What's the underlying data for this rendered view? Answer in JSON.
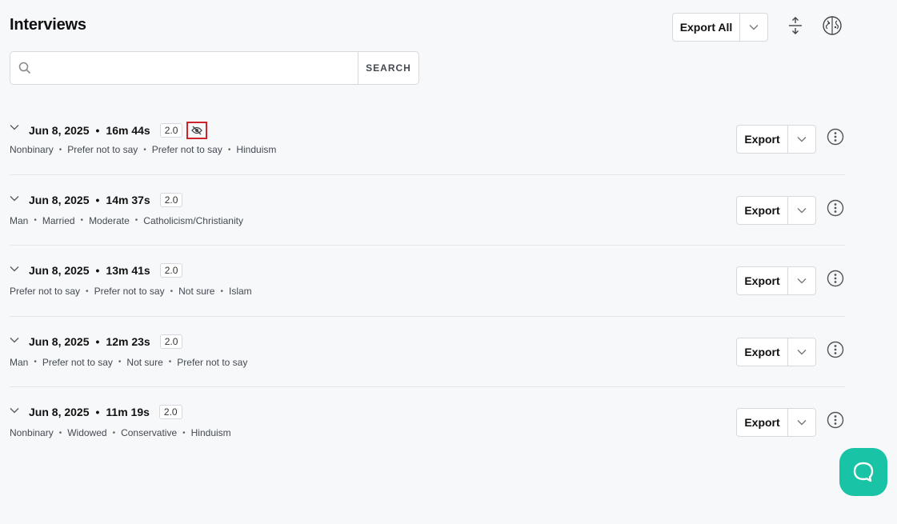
{
  "header": {
    "title": "Interviews",
    "export_all_label": "Export All",
    "icons": {
      "expand": "expand-collapse-icon",
      "ai": "brain-icon"
    }
  },
  "search": {
    "value": "",
    "placeholder": "",
    "button_label": "SEARCH"
  },
  "interviews": [
    {
      "date": "Jun 8, 2025",
      "duration": "16m 44s",
      "version": "2.0",
      "hidden": true,
      "attributes": [
        "Nonbinary",
        "Prefer not to say",
        "Prefer not to say",
        "Hinduism"
      ],
      "export_label": "Export"
    },
    {
      "date": "Jun 8, 2025",
      "duration": "14m 37s",
      "version": "2.0",
      "hidden": false,
      "attributes": [
        "Man",
        "Married",
        "Moderate",
        "Catholicism/Christianity"
      ],
      "export_label": "Export"
    },
    {
      "date": "Jun 8, 2025",
      "duration": "13m 41s",
      "version": "2.0",
      "hidden": false,
      "attributes": [
        "Prefer not to say",
        "Prefer not to say",
        "Not sure",
        "Islam"
      ],
      "export_label": "Export"
    },
    {
      "date": "Jun 8, 2025",
      "duration": "12m 23s",
      "version": "2.0",
      "hidden": false,
      "attributes": [
        "Man",
        "Prefer not to say",
        "Not sure",
        "Prefer not to say"
      ],
      "export_label": "Export"
    },
    {
      "date": "Jun 8, 2025",
      "duration": "11m 19s",
      "version": "2.0",
      "hidden": false,
      "attributes": [
        "Nonbinary",
        "Widowed",
        "Conservative",
        "Hinduism"
      ],
      "export_label": "Export"
    }
  ],
  "colors": {
    "accent": "#19c3a6",
    "highlight_border": "#d0232b",
    "background": "#f7f8fa"
  }
}
